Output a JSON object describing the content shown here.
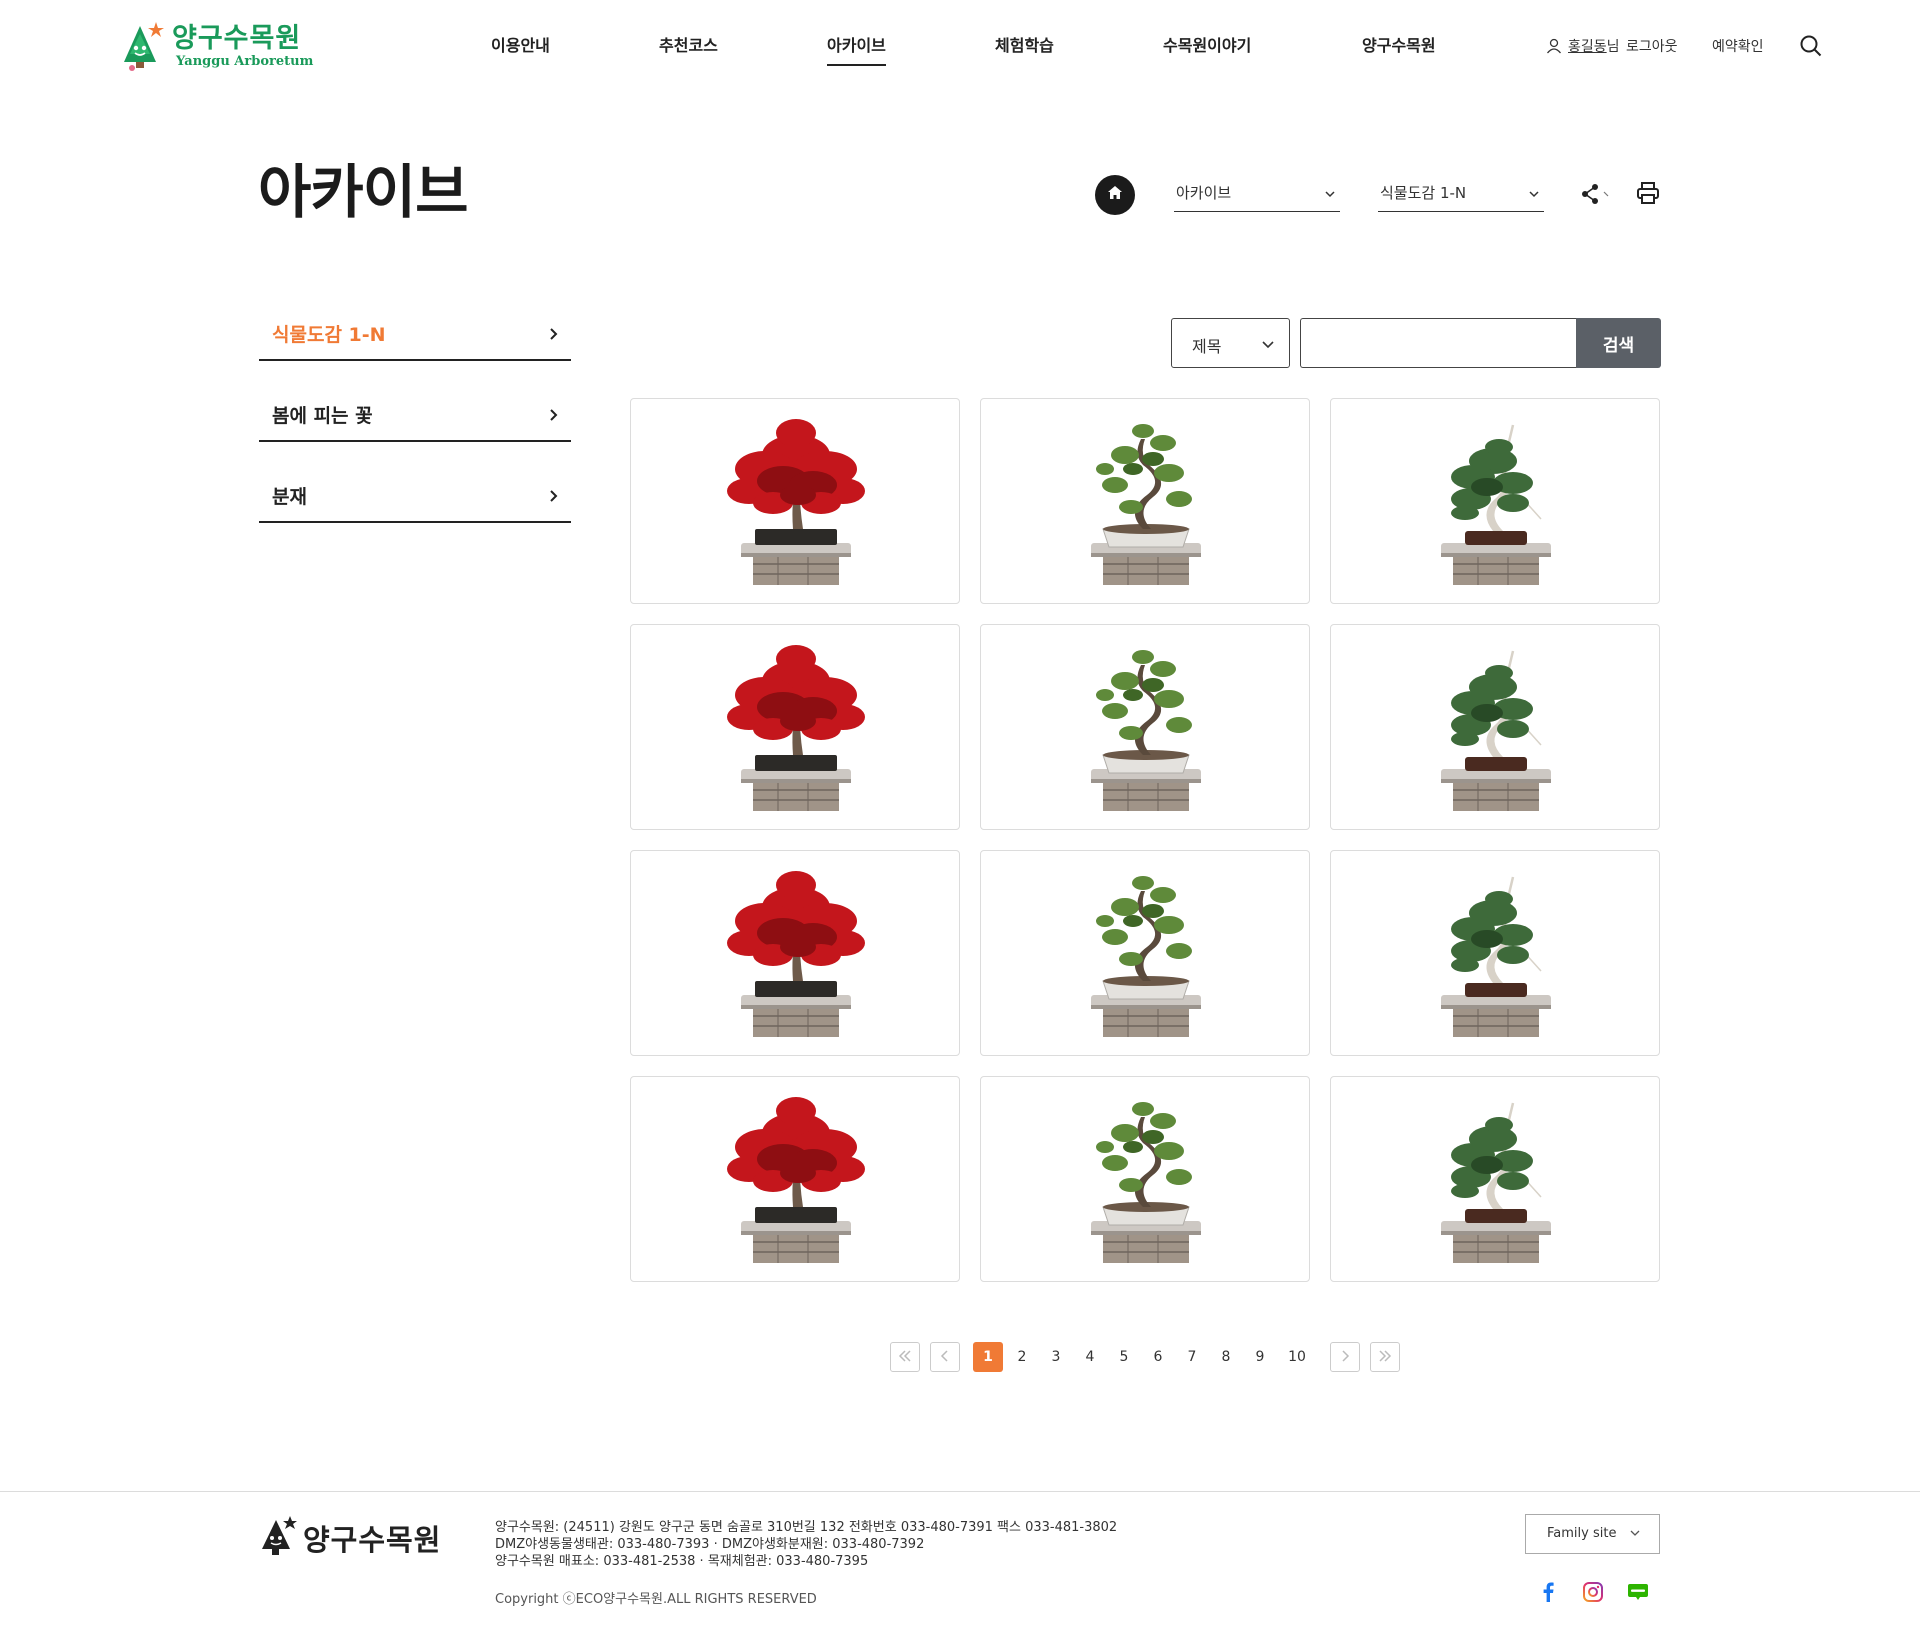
{
  "header": {
    "logo_ko": "양구수목원",
    "logo_en": "Yanggu Arboretum",
    "nav": [
      {
        "label": "이용안내"
      },
      {
        "label": "추천코스"
      },
      {
        "label": "아카이브",
        "active": true
      },
      {
        "label": "체험학습"
      },
      {
        "label": "수목원이야기"
      },
      {
        "label": "양구수목원"
      }
    ],
    "user_name": "홍길동",
    "user_suffix": "님",
    "logout_label": "로그아웃",
    "reservation_label": "예약확인",
    "search_icon": "search-icon"
  },
  "page": {
    "title": "아카이브",
    "breadcrumb": [
      "아카이브",
      "식물도감 1-N"
    ]
  },
  "sidebar": {
    "items": [
      {
        "label": "식물도감 1-N",
        "active": true
      },
      {
        "label": "봄에 피는 꽃"
      },
      {
        "label": "분재"
      }
    ]
  },
  "search": {
    "field_selected": "제목",
    "input_value": "",
    "button_label": "검색"
  },
  "gallery": {
    "rows": 4,
    "columns": 3,
    "items": [
      "red-maple-bonsai",
      "pine-bonsai",
      "juniper-bonsai"
    ]
  },
  "pagination": {
    "pages": [
      "1",
      "2",
      "3",
      "4",
      "5",
      "6",
      "7",
      "8",
      "9",
      "10"
    ],
    "current": "1"
  },
  "footer": {
    "logo_text": "양구수목원",
    "address": "양구수목원: (24511) 강원도 양구군 동면 숨골로 310번길 132 전화번호 033-480-7391 팩스 033-481-3802",
    "dmz": "DMZ야생동물생태관: 033-480-7393 · DMZ야생화분재원: 033-480-7392",
    "shop": "양구수목원 매표소: 033-481-2538 · 목재체험관: 033-480-7395",
    "copyright": "Copyright ⓒECO양구수목원.ALL RIGHTS RESERVED",
    "family_site_label": "Family site",
    "sns": [
      "facebook-icon",
      "instagram-icon",
      "blog-icon"
    ]
  },
  "colors": {
    "accent": "#f07a35",
    "logo_green": "#1a9a5a",
    "search_button": "#5b6067"
  }
}
